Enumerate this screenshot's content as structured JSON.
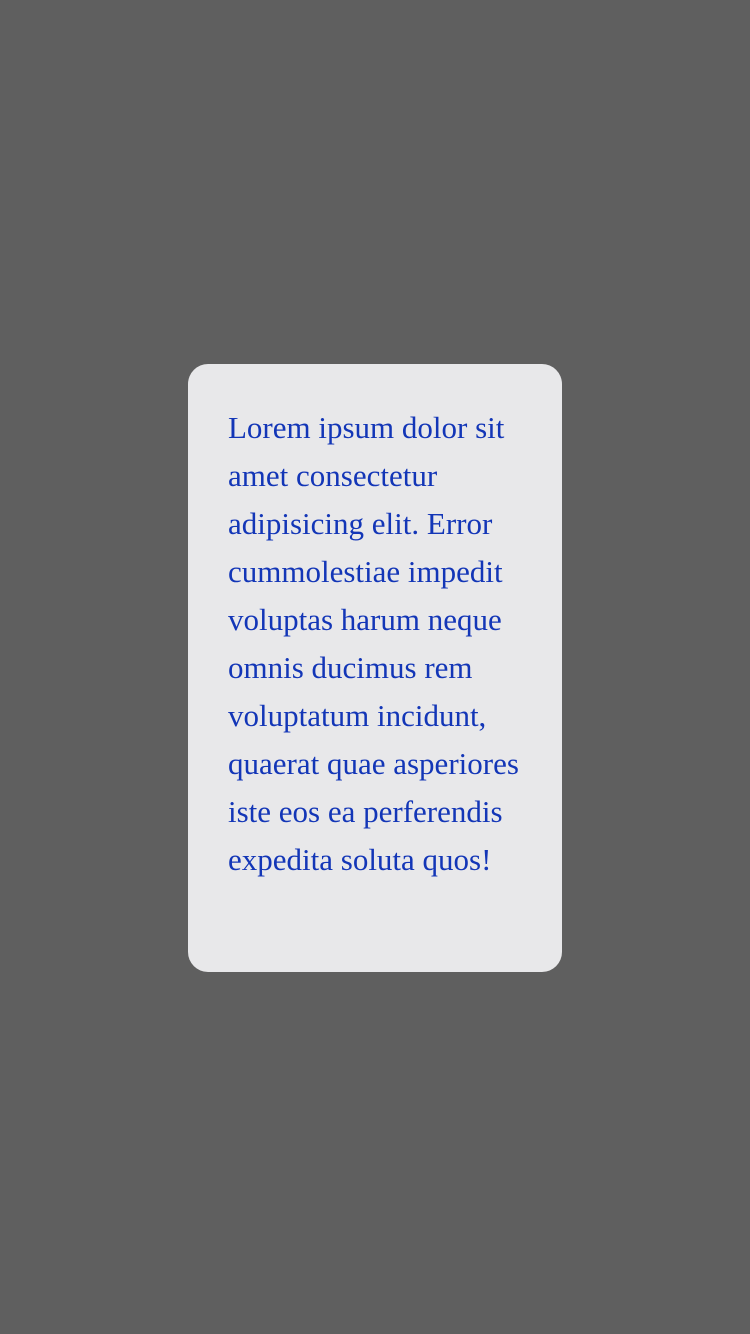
{
  "modal": {
    "message": "Lorem ipsum dolor sit amet consectetur adipisicing elit. Error cummolestiae impedit voluptas harum neque omnis ducimus rem voluptatum incidunt, quaerat quae asperiores iste eos ea perferendis expedita soluta quos!"
  },
  "colors": {
    "overlay": "#5f5f5f",
    "dialog_background": "#e8e8ea",
    "text": "#1336b7"
  }
}
